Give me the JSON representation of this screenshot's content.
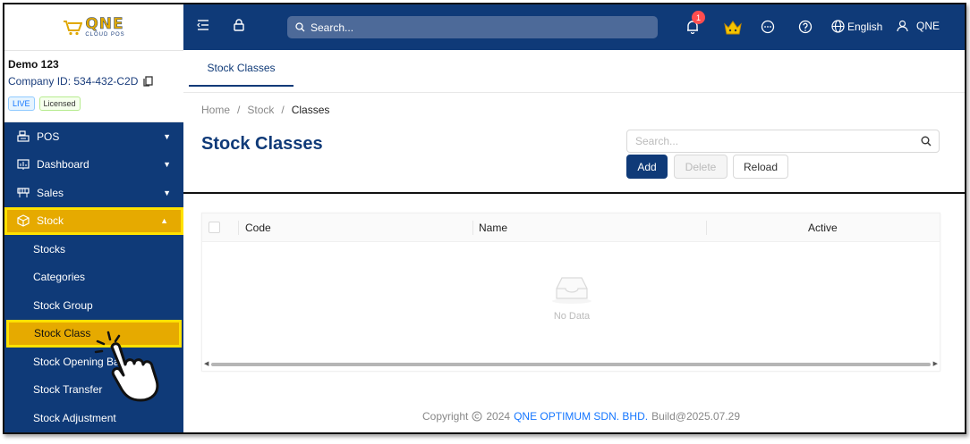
{
  "app": {
    "logo_text": "QNE",
    "logo_subtext": "CLOUD POS"
  },
  "company": {
    "name": "Demo 123",
    "id_label": "Company ID: 534-432-C2D",
    "badge_live": "LIVE",
    "badge_licensed": "Licensed"
  },
  "sidebar": {
    "items": [
      {
        "label": "POS",
        "icon": "pos-terminal-icon",
        "expanded": false
      },
      {
        "label": "Dashboard",
        "icon": "dashboard-chart-icon",
        "expanded": false
      },
      {
        "label": "Sales",
        "icon": "sales-register-icon",
        "expanded": false
      },
      {
        "label": "Stock",
        "icon": "box-icon",
        "expanded": true
      }
    ],
    "stock_sub": [
      {
        "label": "Stocks"
      },
      {
        "label": "Categories"
      },
      {
        "label": "Stock Group"
      },
      {
        "label": "Stock Class"
      },
      {
        "label": "Stock Opening Ba..."
      },
      {
        "label": "Stock Transfer"
      },
      {
        "label": "Stock Adjustment"
      }
    ]
  },
  "topbar": {
    "search_placeholder": "Search...",
    "notification_count": "1",
    "language": "English",
    "user": "QNE"
  },
  "tabs": [
    {
      "label": "Stock Classes"
    }
  ],
  "breadcrumb": {
    "home": "Home",
    "sep": "/",
    "section": "Stock",
    "current": "Classes"
  },
  "page": {
    "title": "Stock Classes",
    "search_placeholder": "Search...",
    "btn_add": "Add",
    "btn_delete": "Delete",
    "btn_reload": "Reload"
  },
  "table": {
    "columns": [
      "Code",
      "Name",
      "Active"
    ],
    "empty_text": "No Data"
  },
  "footer": {
    "copyright": "Copyright",
    "year": "2024",
    "org": "QNE OPTIMUM SDN. BHD.",
    "build": "Build@2025.07.29"
  },
  "colors": {
    "primary": "#0f3a78",
    "highlight": "#e6aa00",
    "highlight_border": "#ffe100",
    "accent_link": "#1677ff"
  }
}
